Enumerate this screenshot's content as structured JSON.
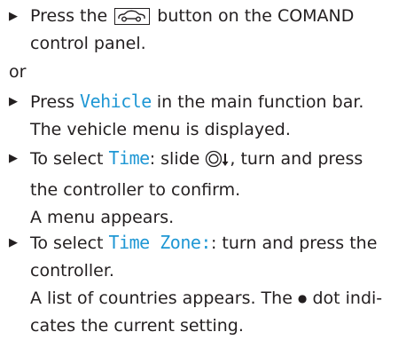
{
  "instructions": {
    "step1": {
      "arrow": "▶",
      "before": "Press the ",
      "icon_name": "vehicle-car-icon",
      "after": " button on the COMAND",
      "line2": "control panel."
    },
    "or": "or",
    "step2": {
      "arrow": "▶",
      "before": "Press ",
      "ui_term": "Vehicle",
      "after": " in the main function bar.",
      "line2": "The vehicle menu is displayed."
    },
    "step3": {
      "arrow": "▶",
      "before": "To select ",
      "ui_term": "Time",
      "middle": ": slide ",
      "icon_name": "controller-slide-down-icon",
      "after": ", turn and press",
      "line2": "the controller to confirm.",
      "line3": "A menu appears."
    },
    "step4": {
      "arrow": "▶",
      "before": "To select ",
      "ui_term": "Time Zone:",
      "after": ": turn and press the",
      "line2": "controller.",
      "line3": "A list of countries appears. The ",
      "dot": "●",
      "line3_after": " dot indi-",
      "line4": "cates the current setting."
    }
  },
  "colors": {
    "text": "#231f20",
    "ui_term": "#1f97d4"
  }
}
